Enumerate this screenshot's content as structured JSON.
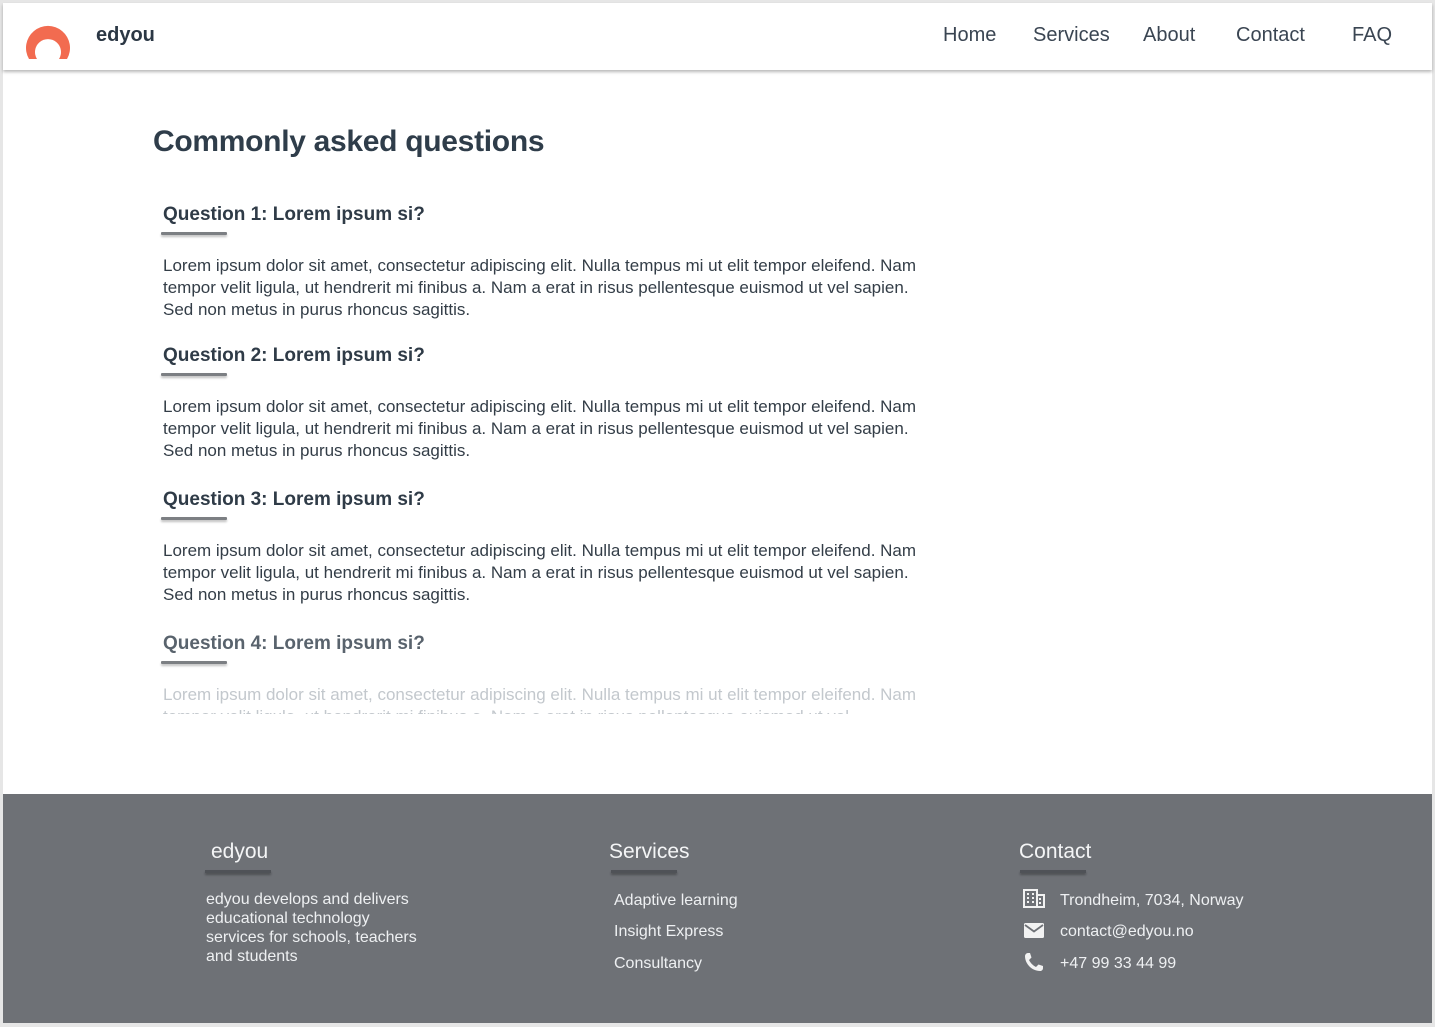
{
  "header": {
    "brand": "edyou",
    "nav": [
      "Home",
      "Services",
      "About",
      "Contact",
      "FAQ"
    ]
  },
  "main": {
    "title": "Commonly asked questions",
    "faqs": [
      {
        "question": "Question 1: Lorem ipsum si?",
        "answer": "Lorem ipsum dolor sit amet, consectetur adipiscing elit. Nulla tempus mi ut elit tempor eleifend. Nam tempor velit ligula, ut hendrerit mi finibus a. Nam a erat in risus pellentesque euismod ut vel sapien. Sed non metus in purus rhoncus sagittis."
      },
      {
        "question": "Question 2: Lorem ipsum si?",
        "answer": "Lorem ipsum dolor sit amet, consectetur adipiscing elit. Nulla tempus mi ut elit tempor eleifend. Nam tempor velit ligula, ut hendrerit mi finibus a. Nam a erat in risus pellentesque euismod ut vel sapien. Sed non metus in purus rhoncus sagittis."
      },
      {
        "question": "Question 3: Lorem ipsum si?",
        "answer": "Lorem ipsum dolor sit amet, consectetur adipiscing elit. Nulla tempus mi ut elit tempor eleifend. Nam tempor velit ligula, ut hendrerit mi finibus a. Nam a erat in risus pellentesque euismod ut vel sapien. Sed non metus in purus rhoncus sagittis."
      },
      {
        "question": "Question 4: Lorem ipsum si?",
        "answer": "Lorem ipsum dolor sit amet, consectetur adipiscing elit. Nulla tempus mi ut elit tempor eleifend. Nam tempor velit ligula, ut hendrerit mi finibus a. Nam a erat in risus pellentesque euismod ut vel"
      }
    ]
  },
  "footer": {
    "about": {
      "heading": "edyou",
      "text": "edyou develops and delivers educational technology services for schools, teachers and students"
    },
    "services": {
      "heading": "Services",
      "links": [
        "Adaptive learning",
        "Insight Express",
        "Consultancy"
      ]
    },
    "contact": {
      "heading": "Contact",
      "address": "Trondheim, 7034, Norway",
      "email": "contact@edyou.no",
      "phone": "+47 99 33 44 99",
      "icons": [
        "building-icon",
        "mail-icon",
        "phone-icon"
      ]
    }
  },
  "colors": {
    "accent": "#f26b50",
    "text": "#2f3b47",
    "footer_bg": "#6e7176"
  }
}
